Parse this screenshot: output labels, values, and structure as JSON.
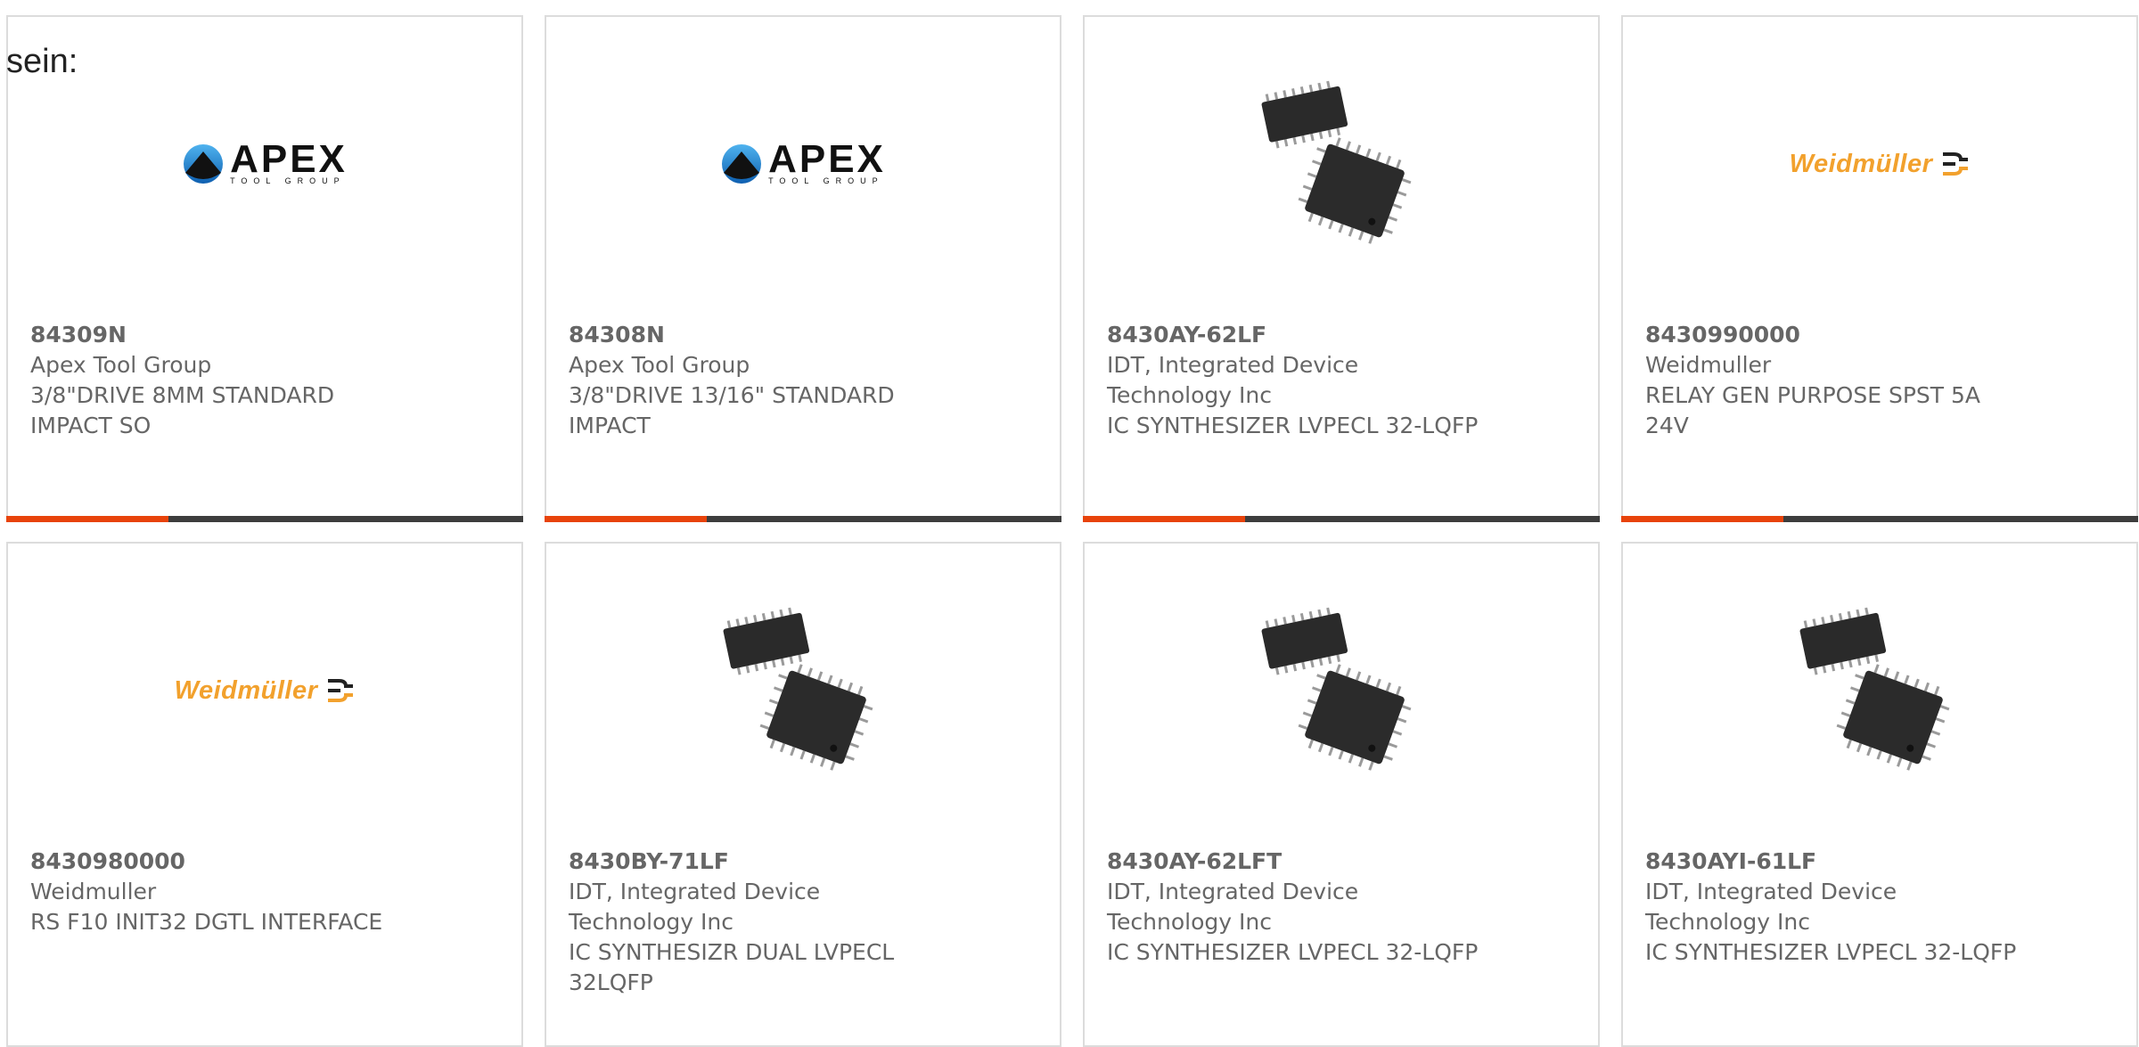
{
  "intro_text": "sein:",
  "products": [
    {
      "part": "84309N",
      "manufacturer": "Apex Tool Group",
      "description": "3/8\"DRIVE 8MM STANDARD IMPACT SO",
      "image": "apex-logo"
    },
    {
      "part": "84308N",
      "manufacturer": "Apex Tool Group",
      "description": "3/8\"DRIVE 13/16\" STANDARD IMPACT",
      "image": "apex-logo"
    },
    {
      "part": "8430AY-62LF",
      "manufacturer": "IDT, Integrated Device Technology Inc",
      "description": "IC SYNTHESIZER LVPECL 32-LQFP",
      "image": "lqfp-chip"
    },
    {
      "part": "8430990000",
      "manufacturer": "Weidmuller",
      "description": "RELAY GEN PURPOSE SPST 5A 24V",
      "image": "weidmuller-logo"
    },
    {
      "part": "8430980000",
      "manufacturer": "Weidmuller",
      "description": "RS F10 INIT32 DGTL INTERFACE",
      "image": "weidmuller-logo"
    },
    {
      "part": "8430BY-71LF",
      "manufacturer": "IDT, Integrated Device Technology Inc",
      "description": "IC SYNTHESIZR DUAL LVPECL 32LQFP",
      "image": "lqfp-chip"
    },
    {
      "part": "8430AY-62LFT",
      "manufacturer": "IDT, Integrated Device Technology Inc",
      "description": "IC SYNTHESIZER LVPECL 32-LQFP",
      "image": "lqfp-chip"
    },
    {
      "part": "8430AYI-61LF",
      "manufacturer": "IDT, Integrated Device Technology Inc",
      "description": "IC SYNTHESIZER LVPECL 32-LQFP",
      "image": "lqfp-chip"
    }
  ],
  "logos": {
    "apex": {
      "word": "APEX",
      "sub": "TOOL GROUP"
    },
    "weidmuller": {
      "word": "Weidmüller"
    }
  },
  "colors": {
    "accent": "#e8430b",
    "bar": "#3d3d3d",
    "weidmuller": "#f2a12d"
  }
}
